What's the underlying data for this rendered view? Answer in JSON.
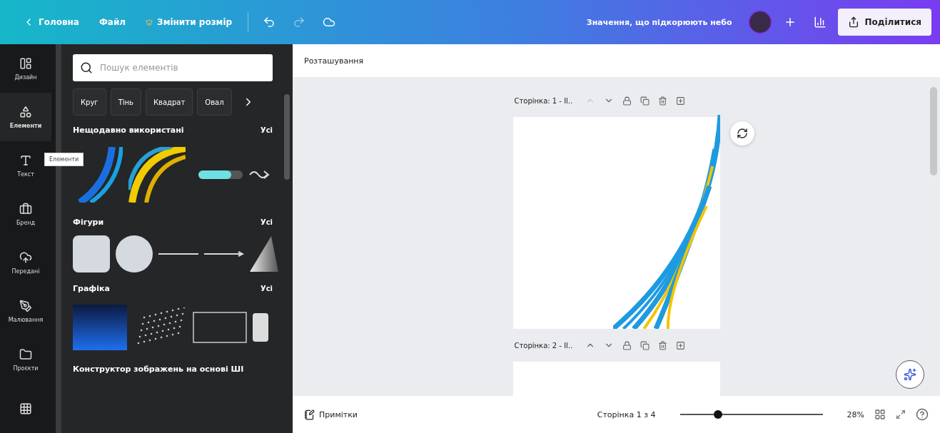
{
  "topbar": {
    "nav": [
      {
        "kind": "home",
        "label": "Головна"
      },
      {
        "kind": "menu",
        "label": "Файл"
      },
      {
        "kind": "resize",
        "label": "Змінити розмір"
      }
    ],
    "undo": {
      "disabled": false
    },
    "redo": {
      "disabled": true
    },
    "title": "Значення, що підкорюють небо",
    "share": "Поділитися"
  },
  "rail": {
    "items": [
      {
        "kind": "design",
        "label": "Дизайн",
        "selected": false
      },
      {
        "kind": "elements",
        "label": "Елементи",
        "selected": true
      },
      {
        "kind": "text",
        "label": "Текст",
        "selected": false
      },
      {
        "kind": "brand",
        "label": "Бренд",
        "selected": false
      },
      {
        "kind": "upload",
        "label": "Передані",
        "selected": false
      },
      {
        "kind": "draw",
        "label": "Малювання",
        "selected": false
      },
      {
        "kind": "projects",
        "label": "Проєкти",
        "selected": false
      },
      {
        "kind": "apps",
        "selected": false
      }
    ],
    "tooltip": "Елементи"
  },
  "panel": {
    "search": {
      "placeholder": "Пошук елементів"
    },
    "chips": [
      "Круг",
      "Тінь",
      "Квадрат",
      "Овал"
    ],
    "sections": [
      {
        "kind": "recent",
        "title": "Нещодавно використані",
        "all": "Усі"
      },
      {
        "kind": "shapes",
        "title": "Фігури",
        "all": "Усі"
      },
      {
        "kind": "graphics",
        "title": "Графіка",
        "all": "Усі"
      },
      {
        "kind": "ai",
        "title": "Конструктор зображень на основі ШІ"
      }
    ]
  },
  "canvas": {
    "header": "Розташування",
    "pages": [
      {
        "label": "Сторінка: 1 - Il..",
        "up_disabled": true,
        "art": true
      },
      {
        "label": "Сторінка: 2 - Il..",
        "up_disabled": false,
        "art": false
      }
    ]
  },
  "bottom": {
    "notes": "Примітки",
    "page_counter": "Сторінка 1 з 4",
    "zoom": {
      "level": 0.25
    },
    "zoom_reading": "28%"
  }
}
